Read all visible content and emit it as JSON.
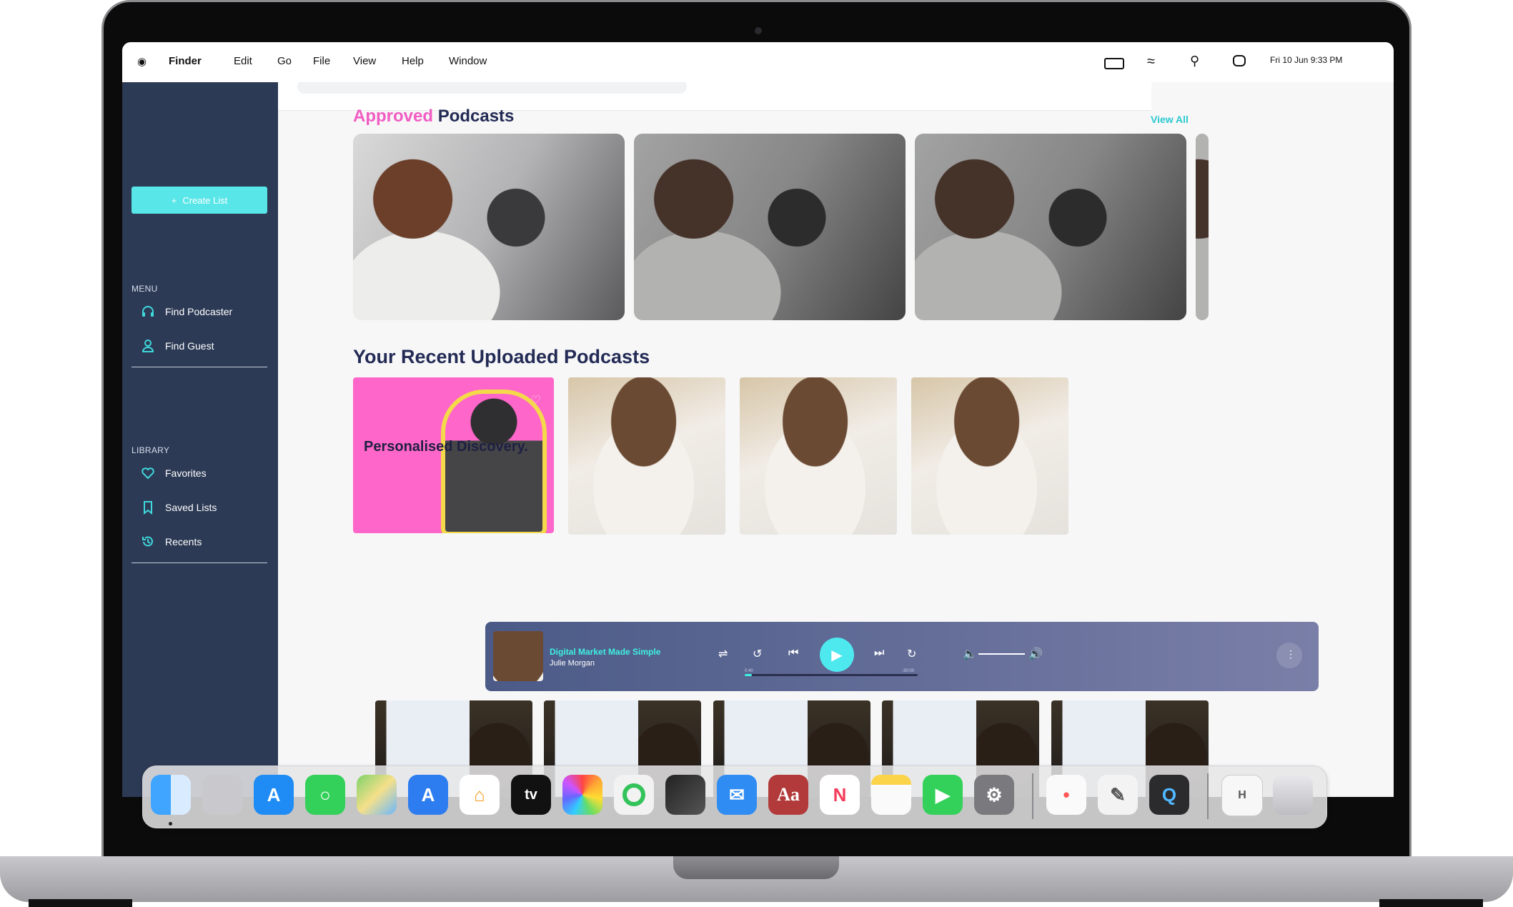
{
  "menubar": {
    "apple": "",
    "app_name": "Finder",
    "menus": [
      "Edit",
      "Go",
      "File",
      "View",
      "Help",
      "Window"
    ],
    "datetime": "Fri 10 Jun  9:33 PM"
  },
  "sidebar": {
    "create_list": "Create List",
    "menu_label": "MENU",
    "menu_items": [
      {
        "label": "Find Podcaster",
        "icon": "headset-icon"
      },
      {
        "label": "Find Guest",
        "icon": "user-icon"
      }
    ],
    "library_label": "LIBRARY",
    "library_items": [
      {
        "label": "Favorites",
        "icon": "heart-icon"
      },
      {
        "label": "Saved Lists",
        "icon": "bookmark-icon"
      },
      {
        "label": "Recents",
        "icon": "history-icon"
      }
    ]
  },
  "approved": {
    "title_accent": "Approved",
    "title_rest": "Podcasts",
    "view_all": "View All"
  },
  "recent": {
    "title": "Your Recent  Uploaded Podcasts",
    "promo_text": "Personalised Discovery."
  },
  "player": {
    "track_title": "Digital Market Made Simple",
    "artist": "Julie Morgan",
    "time_current": "0:40",
    "time_total": "-30:00",
    "progress": 0.04
  },
  "dock": {
    "apps": [
      "finder-icon",
      "launchpad-icon",
      "app-store-icon",
      "messages-icon",
      "maps-icon",
      "xcode-icon",
      "home-icon",
      "apple-tv-icon",
      "photos-icon",
      "find-my-icon",
      "final-cut-icon",
      "mail-icon",
      "dictionary-icon",
      "news-icon",
      "notes-icon",
      "facetime-icon",
      "system-settings-icon",
      "reminders-icon",
      "textedit-icon",
      "quicktime-icon",
      "document-icon",
      "trash-icon"
    ],
    "tv_label": "tv",
    "dict_label": "Aa"
  }
}
